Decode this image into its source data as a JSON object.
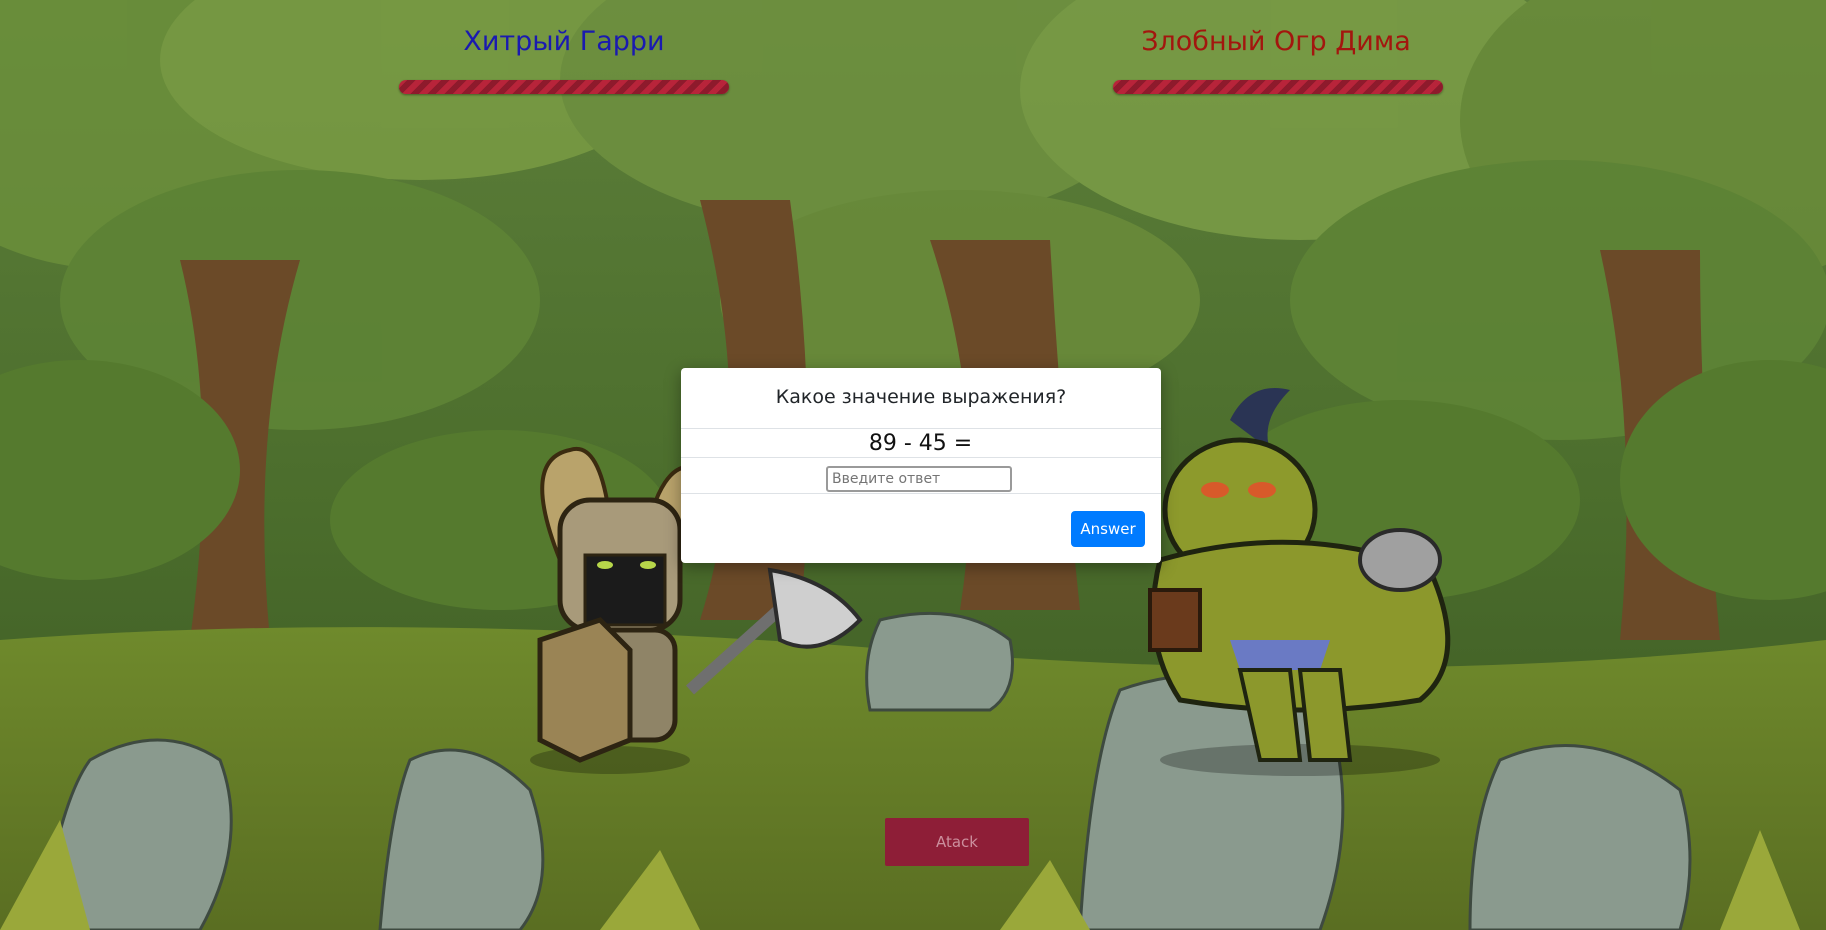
{
  "player": {
    "name": "Хитрый Гарри",
    "name_color": "#1a1ab0",
    "hp_bar_color": "#b8243a"
  },
  "enemy": {
    "name": "Злобный Огр Дима",
    "name_color": "#a3160e",
    "hp_bar_color": "#b8243a"
  },
  "modal": {
    "title": "Какое значение выражения?",
    "expression": "89 - 45 =",
    "input_placeholder": "Введите ответ",
    "input_value": "",
    "answer_label": "Answer"
  },
  "attack_label": "Atack",
  "colors": {
    "answer_button": "#007bff",
    "attack_button": "#8e1e37"
  }
}
